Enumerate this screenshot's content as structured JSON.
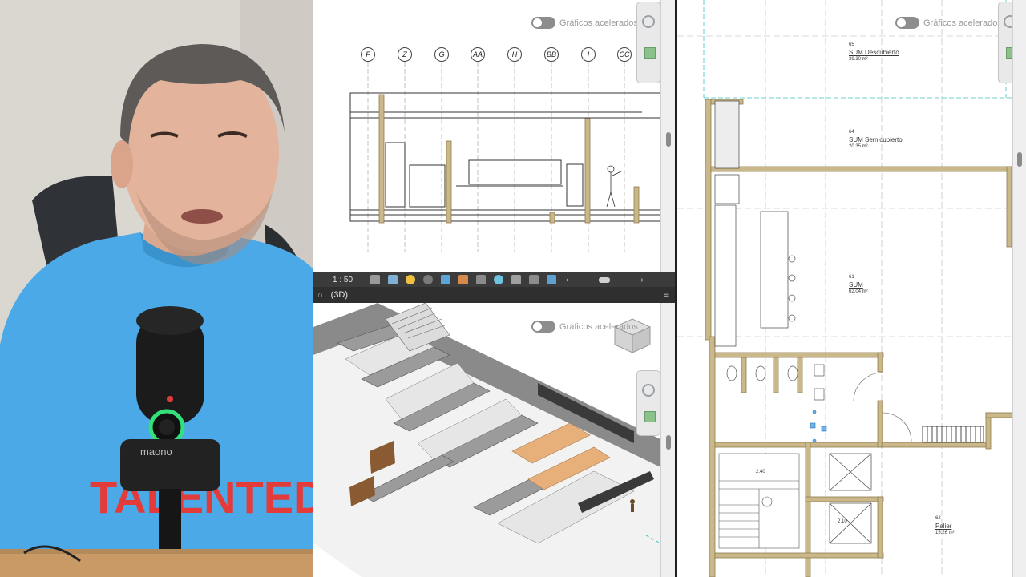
{
  "accelerated_graphics_label": "Gráficos acelerados",
  "elevation_view": {
    "grid_labels": [
      "F",
      "Z",
      "G",
      "AA",
      "H",
      "BB",
      "I",
      "CC"
    ],
    "scale": "1 : 50"
  },
  "view_3d": {
    "tab_label": "(3D)"
  },
  "plan_view": {
    "rooms": [
      {
        "number": "65",
        "name": "SUM Descubierto",
        "area": "39.30 m²"
      },
      {
        "number": "64",
        "name": "SUM Semicubierto",
        "area": "20.35 m²"
      },
      {
        "number": "61",
        "name": "SUM",
        "area": "62.04 m²"
      },
      {
        "number": "62",
        "name": "Palier",
        "area": "15.26 m²"
      }
    ],
    "dimensions": [
      "2.40",
      "2.10"
    ]
  },
  "webcam": {
    "shirt_text": "TALENTED",
    "mic_brand": "maono"
  },
  "colors": {
    "wall_fill": "#cbb88a",
    "wall_dark": "#8f7d4f",
    "wood": "#e7b07a",
    "shirt": "#4aa9e6"
  }
}
